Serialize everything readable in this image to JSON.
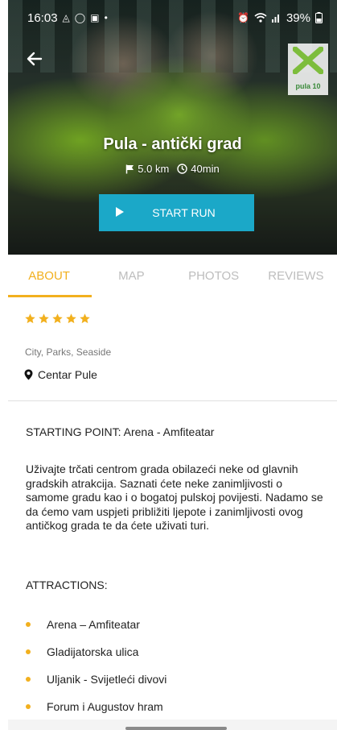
{
  "status_bar": {
    "time": "16:03",
    "battery": "39%",
    "left_icons": [
      "notification-icon",
      "whatsapp-icon",
      "instagram-icon",
      "dot-icon"
    ],
    "right_icons": [
      "alarm-icon",
      "wifi-icon",
      "signal-icon",
      "battery-icon"
    ]
  },
  "route": {
    "title": "Pula - antički grad",
    "distance": "5.0 km",
    "duration": "40min",
    "start_label": "START RUN",
    "logo_text": "pula 10"
  },
  "tabs": [
    {
      "label": "ABOUT",
      "active": true
    },
    {
      "label": "MAP",
      "active": false
    },
    {
      "label": "PHOTOS",
      "active": false
    },
    {
      "label": "REVIEWS",
      "active": false
    }
  ],
  "about": {
    "rating": 5,
    "rating_max": 5,
    "categories": "City, Parks, Seaside",
    "location": "Centar Pule",
    "starting_point_label": "STARTING POINT:",
    "starting_point_value": "Arena - Amfiteatar",
    "description": "Uživajte trčati centrom grada obilazeći neke od glavnih gradskih atrakcija. Saznati ćete neke zanimljivosti o samome gradu kao i o bogatoj pulskoj povijesti. Nadamo se da ćemo vam uspjeti približiti ljepote i zanimljivosti ovog antičkog grada te da ćete uživati turi.",
    "attractions_title": "ATTRACTIONS:",
    "attractions": [
      "Arena – Amfiteatar",
      "Gladijatorska ulica",
      "Uljanik - Svijetleći divovi",
      "Forum i Augustov hram"
    ]
  },
  "colors": {
    "accent": "#f2b01e",
    "start_button": "#1ba8c8",
    "inactive_tab": "#bdbdbd"
  }
}
